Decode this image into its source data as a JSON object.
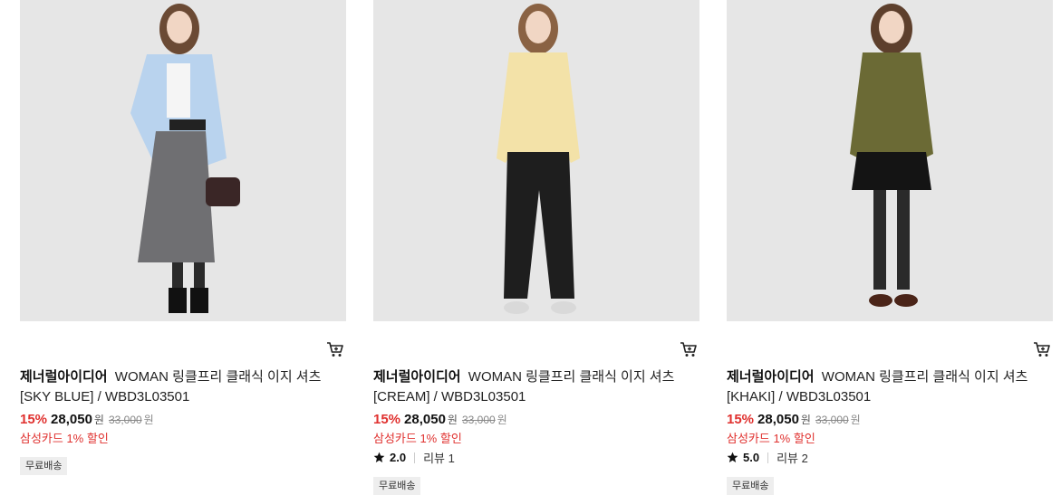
{
  "products": [
    {
      "brand": "제너럴아이디어",
      "name": "WOMAN 링클프리 클래식 이지 셔츠",
      "variant": "[SKY BLUE] / WBD3L03501",
      "discount": "15%",
      "price": "28,050",
      "currency": "원",
      "original_price": "33,000",
      "promo": "삼성카드 1% 할인",
      "rating": null,
      "review_label": null,
      "badge": "무료배송",
      "shirt_color": "#b9d3ee"
    },
    {
      "brand": "제너럴아이디어",
      "name": "WOMAN 링클프리 클래식 이지 셔츠",
      "variant": "[CREAM] / WBD3L03501",
      "discount": "15%",
      "price": "28,050",
      "currency": "원",
      "original_price": "33,000",
      "promo": "삼성카드 1% 할인",
      "rating": "2.0",
      "review_label": "리뷰 1",
      "badge": "무료배송",
      "shirt_color": "#f3e2a8"
    },
    {
      "brand": "제너럴아이디어",
      "name": "WOMAN 링클프리 클래식 이지 셔츠",
      "variant": "[KHAKI] / WBD3L03501",
      "discount": "15%",
      "price": "28,050",
      "currency": "원",
      "original_price": "33,000",
      "promo": "삼성카드 1% 할인",
      "rating": "5.0",
      "review_label": "리뷰 2",
      "badge": "무료배송",
      "shirt_color": "#6b6a35"
    }
  ],
  "icons": {
    "cart": "cart-icon",
    "star": "star-icon"
  },
  "colors": {
    "discount_red": "#e0312f",
    "badge_bg": "#eeeeee",
    "image_bg": "#e6e6e6"
  }
}
